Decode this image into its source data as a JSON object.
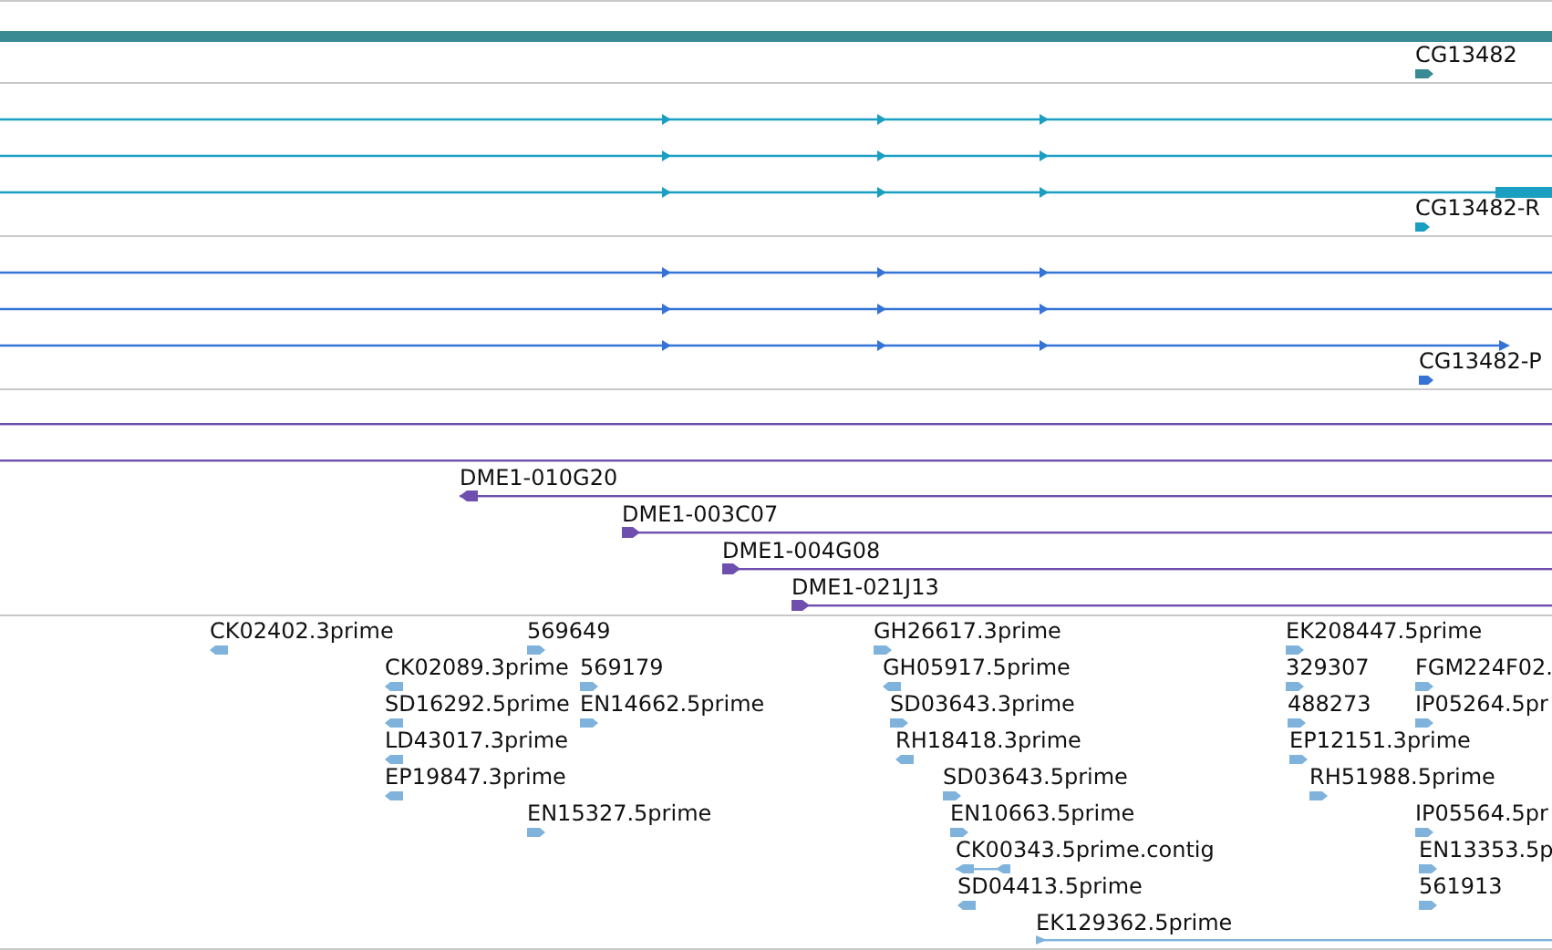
{
  "tracks": [
    {
      "kind": "gene",
      "features": [
        {
          "label": "CG13482",
          "reverse": false
        }
      ]
    },
    {
      "kind": "transcripts",
      "transcripts": [
        {
          "reverse": false
        },
        {
          "reverse": false
        },
        {
          "reverse": false
        }
      ],
      "features": [
        {
          "label": "CG13482-R",
          "reverse": false
        }
      ]
    },
    {
      "kind": "transcripts",
      "transcripts": [
        {
          "reverse": false
        },
        {
          "reverse": false
        },
        {
          "reverse": false
        }
      ],
      "features": [
        {
          "label": "CG13482-P",
          "reverse": false
        }
      ]
    },
    {
      "kind": "clones",
      "features": [
        {
          "label": "DME1-010G20",
          "reverse": true
        },
        {
          "label": "DME1-003C07",
          "reverse": false
        },
        {
          "label": "DME1-004G08",
          "reverse": false
        },
        {
          "label": "DME1-021J13",
          "reverse": false
        }
      ]
    },
    {
      "kind": "ests",
      "features": [
        {
          "label": "CK02402.3prime",
          "reverse": true
        },
        {
          "label": "569649",
          "reverse": false
        },
        {
          "label": "CK02089.3prime",
          "reverse": true
        },
        {
          "label": "569179",
          "reverse": false
        },
        {
          "label": "SD16292.5prime",
          "reverse": true
        },
        {
          "label": "EN14662.5prime",
          "reverse": false
        },
        {
          "label": "LD43017.3prime",
          "reverse": true
        },
        {
          "label": "EP19847.3prime",
          "reverse": true
        },
        {
          "label": "EN15327.5prime",
          "reverse": false
        },
        {
          "label": "GH26617.3prime",
          "reverse": false
        },
        {
          "label": "GH05917.5prime",
          "reverse": true
        },
        {
          "label": "SD03643.3prime",
          "reverse": false
        },
        {
          "label": "RH18418.3prime",
          "reverse": true
        },
        {
          "label": "SD03643.5prime",
          "reverse": false
        },
        {
          "label": "EN10663.5prime",
          "reverse": false
        },
        {
          "label": "CK00343.5prime.contig",
          "reverse": true
        },
        {
          "label": "SD04413.5prime",
          "reverse": true
        },
        {
          "label": "EK129362.5prime",
          "reverse": false
        },
        {
          "label": "EK208447.5prime",
          "reverse": false
        },
        {
          "label": "329307",
          "reverse": false
        },
        {
          "label": "FGM224F02.",
          "reverse": false
        },
        {
          "label": "488273",
          "reverse": false
        },
        {
          "label": "IP05264.5pr",
          "reverse": false
        },
        {
          "label": "EP12151.3prime",
          "reverse": false
        },
        {
          "label": "RH51988.5prime",
          "reverse": false
        },
        {
          "label": "IP05564.5pr",
          "reverse": false
        },
        {
          "label": "EN13353.5p",
          "reverse": false
        },
        {
          "label": "561913",
          "reverse": false
        }
      ]
    }
  ]
}
